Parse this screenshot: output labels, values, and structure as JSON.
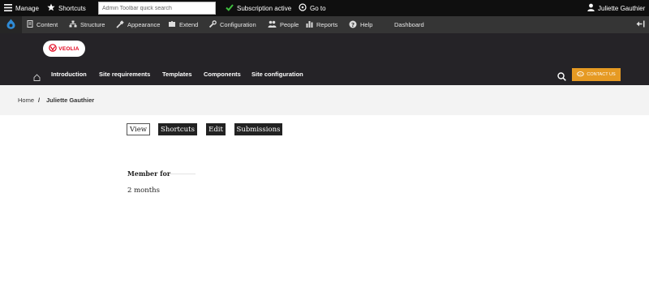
{
  "toolbar": {
    "manage": "Manage",
    "shortcuts": "Shortcuts",
    "search_placeholder": "Admin Toolbar quick search",
    "subscription": "Subscription active",
    "goto": "Go to",
    "user": "Juliette Gauthier"
  },
  "tray": {
    "items": [
      "Content",
      "Structure",
      "Appearance",
      "Extend",
      "Configuration",
      "People",
      "Reports",
      "Help",
      "Dashboard"
    ]
  },
  "header": {
    "logo_text": "VEOLIA",
    "nav": [
      "Introduction",
      "Site requirements",
      "Templates",
      "Components",
      "Site configuration"
    ],
    "contact_label": "CONTACT US"
  },
  "breadcrumb": {
    "home": "Home",
    "separator": "/",
    "current": "Juliette Gauthier"
  },
  "tabs": [
    "View",
    "Shortcuts",
    "Edit",
    "Submissions"
  ],
  "profile": {
    "member_for_label": "Member for",
    "member_for_value": "2 months"
  },
  "colors": {
    "toolbar_bg": "#0f0f0f",
    "tray_bg": "#353535",
    "header_bg": "#252327",
    "accent": "#e69a23",
    "subscription_check": "#3fbf3f",
    "brand_red": "#e2001a"
  }
}
